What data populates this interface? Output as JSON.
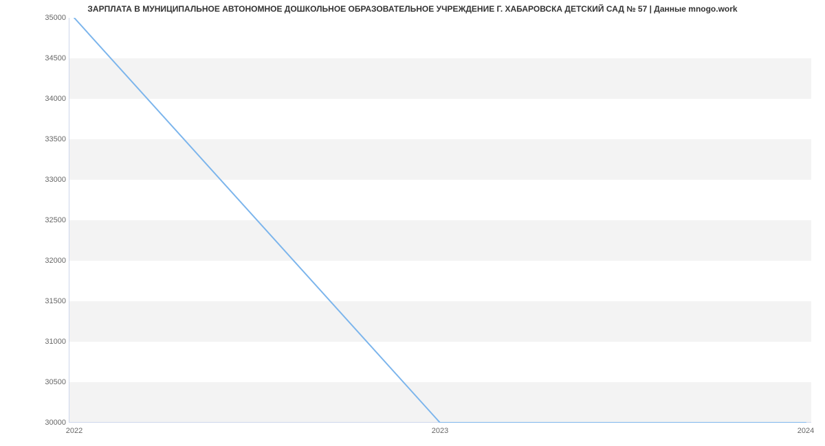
{
  "chart_data": {
    "type": "line",
    "title": "ЗАРПЛАТА В МУНИЦИПАЛЬНОЕ АВТОНОМНОЕ ДОШКОЛЬНОЕ ОБРАЗОВАТЕЛЬНОЕ УЧРЕЖДЕНИЕ Г. ХАБАРОВСКА ДЕТСКИЙ САД № 57 | Данные mnogo.work",
    "x": [
      2022,
      2023,
      2024
    ],
    "values": [
      35000,
      30000,
      30000
    ],
    "xlabel": "",
    "ylabel": "",
    "xlim": [
      2022,
      2024
    ],
    "ylim": [
      30000,
      35000
    ],
    "x_ticks": [
      "2022",
      "2023",
      "2024"
    ],
    "y_ticks": [
      "30000",
      "30500",
      "31000",
      "31500",
      "32000",
      "32500",
      "33000",
      "33500",
      "34000",
      "34500",
      "35000"
    ],
    "line_color": "#7cb5ec",
    "grid_band_color": "#f3f3f3"
  }
}
